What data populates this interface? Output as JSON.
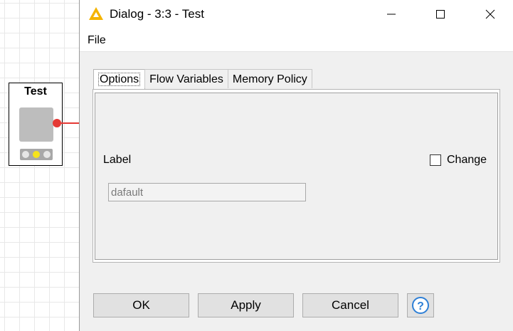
{
  "canvas": {
    "node": {
      "title": "Test",
      "status_light": "yellow",
      "port_color": "#e53935"
    }
  },
  "window": {
    "title": "Dialog - 3:3 - Test",
    "icon": "knime-triangle-icon",
    "accent_color": "#f5b400",
    "controls": {
      "minimize": "—",
      "maximize": "☐",
      "close": "✕"
    }
  },
  "menubar": {
    "file_label": "File"
  },
  "tabs": [
    {
      "label": "Options",
      "active": true
    },
    {
      "label": "Flow Variables",
      "active": false
    },
    {
      "label": "Memory Policy",
      "active": false
    }
  ],
  "options_panel": {
    "label_caption": "Label",
    "label_value": "dafault",
    "change_label": "Change",
    "change_checked": false
  },
  "buttons": {
    "ok": "OK",
    "apply": "Apply",
    "cancel": "Cancel",
    "help_icon": "help-question-icon"
  }
}
